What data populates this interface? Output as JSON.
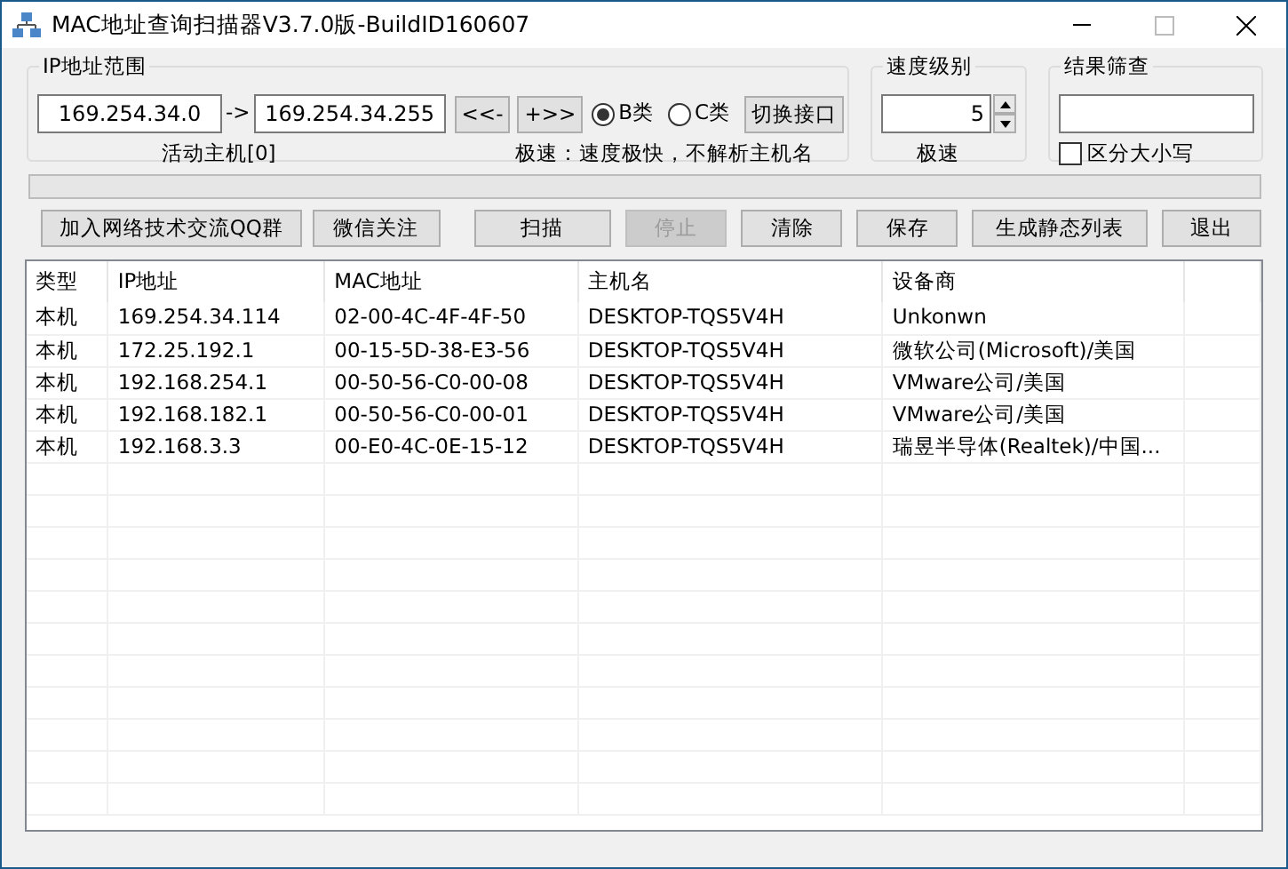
{
  "window": {
    "title": "MAC地址查询扫描器V3.7.0版-BuildID160607"
  },
  "ip_range": {
    "title": "IP地址范围",
    "start": "169.254.34.0",
    "arrow": "->",
    "end": "169.254.34.255",
    "prev_button": "<<-",
    "next_button": "+>>",
    "classes": [
      {
        "label": "B类",
        "selected": true
      },
      {
        "label": "C类",
        "selected": false
      }
    ],
    "switch_button": "切换接口",
    "active_hosts": "活动主机[0]",
    "speed_note": "极速：速度极快，不解析主机名"
  },
  "speed": {
    "title": "速度级别",
    "value": "5",
    "caption": "极速"
  },
  "filter": {
    "title": "结果筛查",
    "case_sensitive": {
      "label": "区分大小写",
      "checked": false
    }
  },
  "progress": {
    "level": 0
  },
  "buttons": [
    {
      "label": "加入网络技术交流QQ群",
      "disabled": false
    },
    {
      "label": "微信关注",
      "disabled": false
    },
    {
      "label": "扫描",
      "disabled": false
    },
    {
      "label": "停止",
      "disabled": true
    },
    {
      "label": "清除",
      "disabled": false
    },
    {
      "label": "保存",
      "disabled": false
    },
    {
      "label": "生成静态列表",
      "disabled": false
    },
    {
      "label": "退出",
      "disabled": false
    }
  ],
  "table": {
    "columns": [
      "类型",
      "IP地址",
      "MAC地址",
      "主机名",
      "设备商"
    ],
    "rows": [
      [
        "本机",
        "169.254.34.114",
        "02-00-4C-4F-4F-50",
        "DESKTOP-TQS5V4H",
        "Unkonwn"
      ],
      [
        "本机",
        "172.25.192.1",
        "00-15-5D-38-E3-56",
        "DESKTOP-TQS5V4H",
        "微软公司(Microsoft)/美国"
      ],
      [
        "本机",
        "192.168.254.1",
        "00-50-56-C0-00-08",
        "DESKTOP-TQS5V4H",
        "VMware公司/美国"
      ],
      [
        "本机",
        "192.168.182.1",
        "00-50-56-C0-00-01",
        "DESKTOP-TQS5V4H",
        "VMware公司/美国"
      ],
      [
        "本机",
        "192.168.3.3",
        "00-E0-4C-0E-15-12",
        "DESKTOP-TQS5V4H",
        "瑞昱半导体(Realtek)/中国..."
      ]
    ]
  }
}
